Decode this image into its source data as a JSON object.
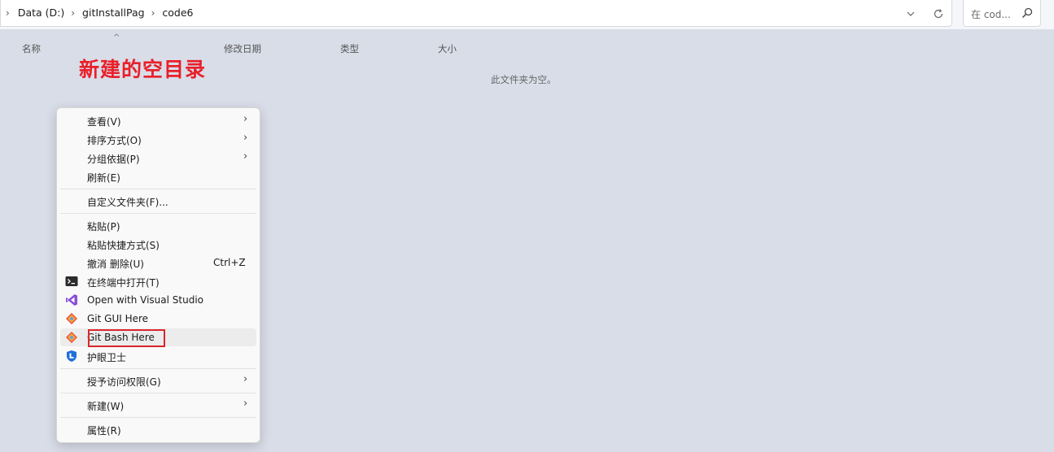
{
  "address_bar": {
    "crumbs": [
      "Data (D:)",
      "gitInstallPag",
      "code6"
    ]
  },
  "search": {
    "placeholder": "在 cod..."
  },
  "columns": {
    "name": "名称",
    "date": "修改日期",
    "type": "类型",
    "size": "大小"
  },
  "empty_message": "此文件夹为空。",
  "annotation": "新建的空目录",
  "context_menu": {
    "items": [
      {
        "label": "查看(V)",
        "submenu": true
      },
      {
        "label": "排序方式(O)",
        "submenu": true
      },
      {
        "label": "分组依据(P)",
        "submenu": true
      },
      {
        "label": "刷新(E)"
      },
      {
        "label": "自定义文件夹(F)..."
      },
      {
        "label": "粘贴(P)"
      },
      {
        "label": "粘贴快捷方式(S)"
      },
      {
        "label": "撤消 删除(U)",
        "shortcut": "Ctrl+Z"
      },
      {
        "label": "在终端中打开(T)",
        "icon": "terminal-icon"
      },
      {
        "label": "Open with Visual Studio",
        "icon": "visual-studio-icon"
      },
      {
        "label": "Git GUI Here",
        "icon": "git-gui-icon"
      },
      {
        "label": "Git Bash Here",
        "icon": "git-bash-icon",
        "highlighted": true
      },
      {
        "label": "护眼卫士",
        "icon": "eye-guard-icon"
      },
      {
        "label": "授予访问权限(G)",
        "submenu": true
      },
      {
        "label": "新建(W)",
        "submenu": true
      },
      {
        "label": "属性(R)"
      }
    ]
  },
  "colors": {
    "annotation": "#e8202a",
    "background": "#d9dde8",
    "highlight_box": "#d9262c"
  }
}
